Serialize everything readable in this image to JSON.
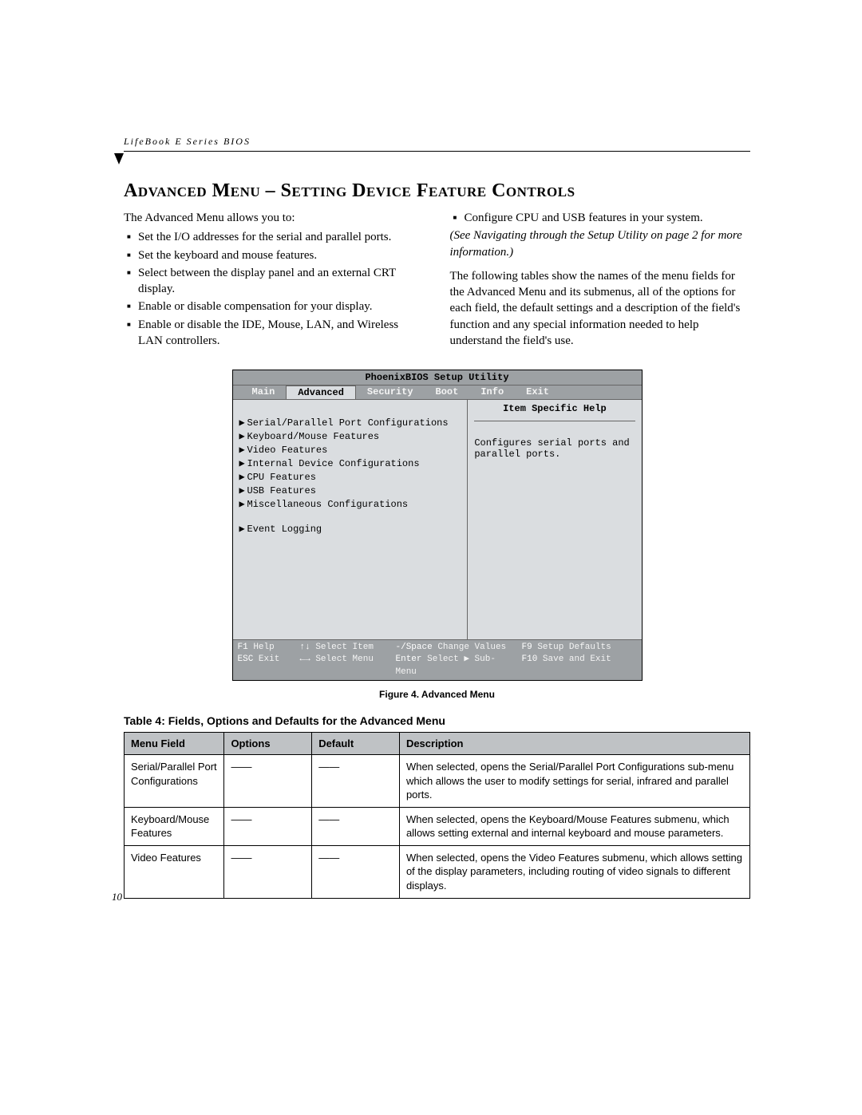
{
  "header": "LifeBook E Series BIOS",
  "title": "Advanced Menu – Setting Device Feature Controls",
  "intro": "The Advanced Menu allows you to:",
  "left_bullets": [
    "Set the I/O addresses for the serial and parallel ports.",
    "Set the keyboard and mouse features.",
    "Select between the display panel and an external CRT display.",
    "Enable or disable compensation for your display.",
    "Enable or disable the IDE, Mouse, LAN, and Wireless LAN controllers."
  ],
  "right_bullet": "Configure CPU and USB features in your system.",
  "cross_ref": "(See Navigating through the Setup Utility on page 2 for more information.)",
  "right_para": "The following tables show the names of the menu fields for the Advanced Menu and its submenus, all of the options for each field, the default settings and a description of the field's function and any special information needed to help understand the field's use.",
  "bios": {
    "utility_title": "PhoenixBIOS Setup Utility",
    "tabs": [
      "Main",
      "Advanced",
      "Security",
      "Boot",
      "Info",
      "Exit"
    ],
    "active_tab": 1,
    "items": [
      "Serial/Parallel Port Configurations",
      "Keyboard/Mouse Features",
      "Video Features",
      "Internal Device Configurations",
      "CPU Features",
      "USB Features",
      "Miscellaneous Configurations"
    ],
    "extra_item": "Event Logging",
    "help_title": "Item Specific Help",
    "help_text": "Configures serial ports and parallel ports.",
    "footer": {
      "r1": {
        "k1": "F1",
        "l1": "Help",
        "k2": "↑↓",
        "l2": "Select Item",
        "k3": "-/Space",
        "l3": "Change Values",
        "k4": "F9",
        "l4": "Setup Defaults"
      },
      "r2": {
        "k1": "ESC",
        "l1": "Exit",
        "k2": "←→",
        "l2": "Select Menu",
        "k3": "Enter",
        "l3": "Select ▶ Sub-Menu",
        "k4": "F10",
        "l4": "Save and Exit"
      }
    }
  },
  "figure_caption": "Figure 4.  Advanced Menu",
  "table_title": "Table 4: Fields, Options and Defaults for the Advanced Menu",
  "table": {
    "headers": [
      "Menu Field",
      "Options",
      "Default",
      "Description"
    ],
    "rows": [
      {
        "field": "Serial/Parallel Port Configurations",
        "options": "——",
        "def": "——",
        "desc": "When selected, opens the Serial/Parallel Port Configurations sub-menu which allows the user to modify settings for serial, infrared and parallel ports."
      },
      {
        "field": "Keyboard/Mouse Features",
        "options": "——",
        "def": "——",
        "desc": "When selected, opens the Keyboard/Mouse Features submenu, which allows setting external and internal keyboard and mouse parameters."
      },
      {
        "field": "Video Features",
        "options": "——",
        "def": "——",
        "desc": "When selected, opens the Video Features submenu, which allows setting of the display parameters, including routing of video signals to different displays."
      }
    ]
  },
  "page_number": "10"
}
